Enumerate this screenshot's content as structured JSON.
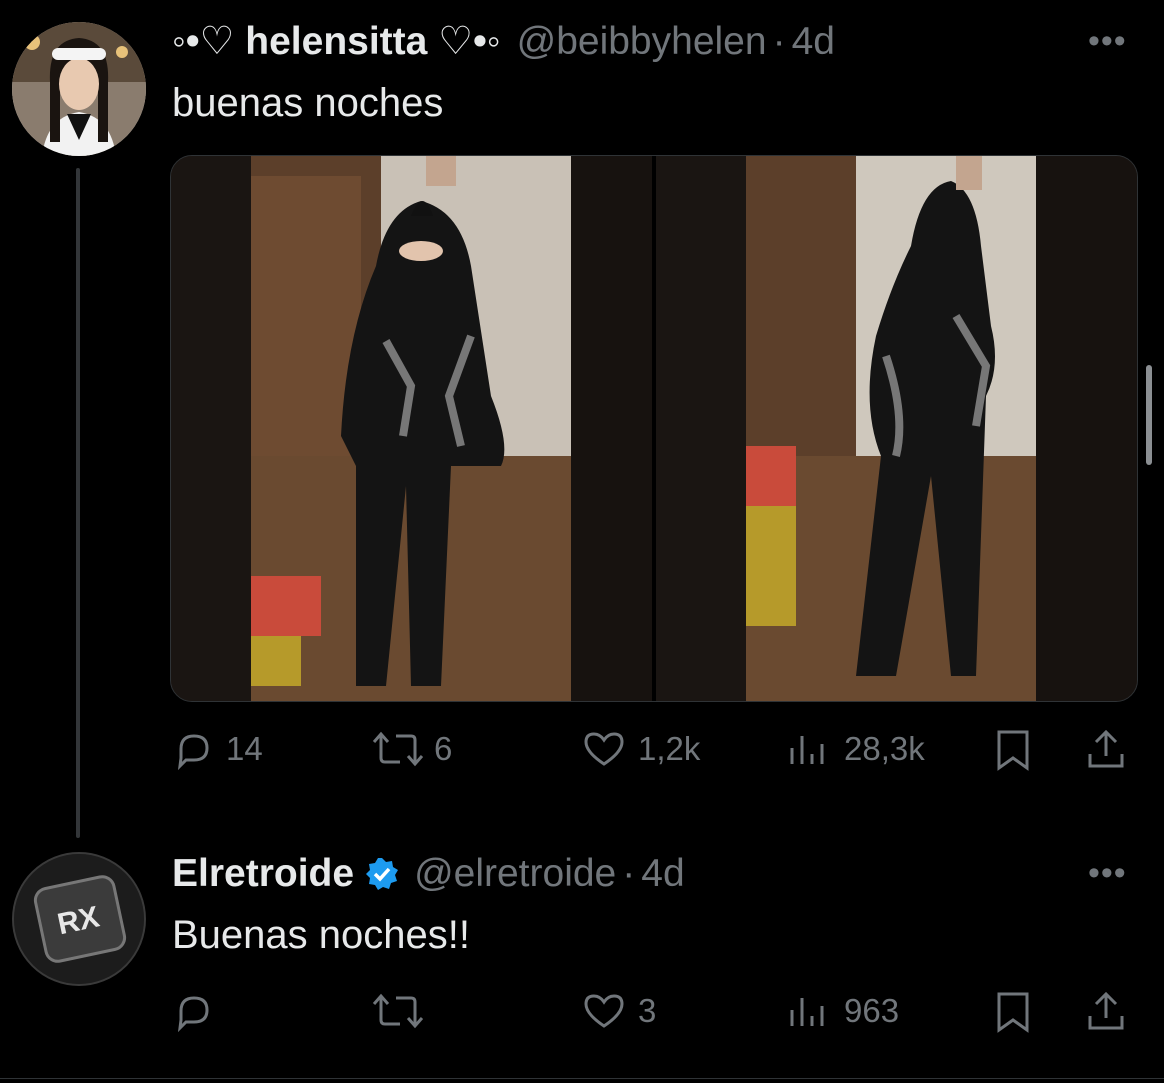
{
  "tweets": [
    {
      "display_name": "◦•♡ helensitta ♡•◦",
      "handle": "@beibbyhelen",
      "sep": "·",
      "time": "4d",
      "text": "buenas noches",
      "media_count": 2,
      "stats": {
        "replies": "14",
        "retweets": "6",
        "likes": "1,2k",
        "views": "28,3k"
      }
    },
    {
      "display_name": "Elretroide",
      "verified": true,
      "avatar_text": "RX",
      "handle": "@elretroide",
      "sep": "·",
      "time": "4d",
      "text": "Buenas noches!!",
      "stats": {
        "replies": "",
        "retweets": "",
        "likes": "3",
        "views": "963"
      }
    }
  ],
  "colors": {
    "background": "#000000",
    "text": "#e7e9ea",
    "muted": "#71767b",
    "verified": "#1d9bf0"
  },
  "icons": [
    "more-icon",
    "reply-icon",
    "retweet-icon",
    "like-icon",
    "views-icon",
    "bookmark-icon",
    "share-icon",
    "verified-badge-icon"
  ]
}
